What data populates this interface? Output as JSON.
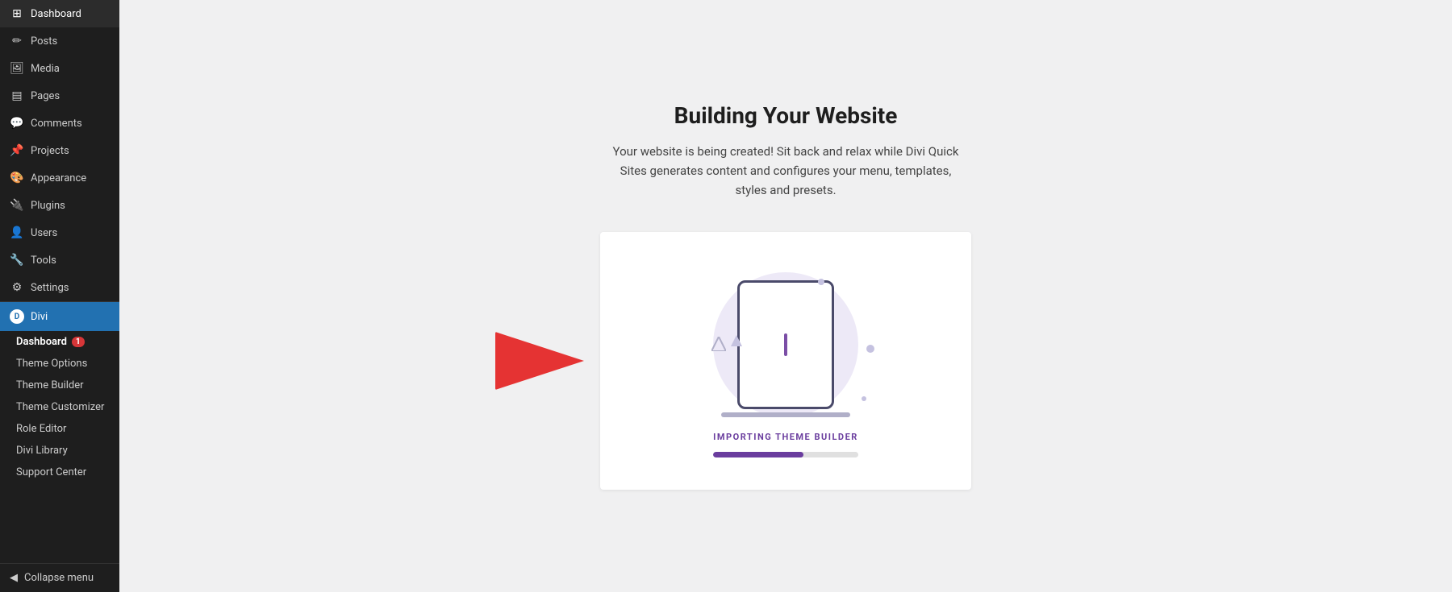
{
  "sidebar": {
    "items": [
      {
        "id": "dashboard",
        "label": "Dashboard",
        "icon": "⊞"
      },
      {
        "id": "posts",
        "label": "Posts",
        "icon": "✎"
      },
      {
        "id": "media",
        "label": "Media",
        "icon": "⊡"
      },
      {
        "id": "pages",
        "label": "Pages",
        "icon": "▤"
      },
      {
        "id": "comments",
        "label": "Comments",
        "icon": "💬"
      },
      {
        "id": "projects",
        "label": "Projects",
        "icon": "📌"
      },
      {
        "id": "appearance",
        "label": "Appearance",
        "icon": "🎨"
      },
      {
        "id": "plugins",
        "label": "Plugins",
        "icon": "🔌"
      },
      {
        "id": "users",
        "label": "Users",
        "icon": "👤"
      },
      {
        "id": "tools",
        "label": "Tools",
        "icon": "🔧"
      },
      {
        "id": "settings",
        "label": "Settings",
        "icon": "⚙"
      }
    ],
    "divi": {
      "header_label": "Divi",
      "icon": "D",
      "sub_items": [
        {
          "id": "divi-dashboard",
          "label": "Dashboard",
          "badge": "1",
          "active": true
        },
        {
          "id": "theme-options",
          "label": "Theme Options"
        },
        {
          "id": "theme-builder",
          "label": "Theme Builder"
        },
        {
          "id": "theme-customizer",
          "label": "Theme Customizer"
        },
        {
          "id": "role-editor",
          "label": "Role Editor"
        },
        {
          "id": "divi-library",
          "label": "Divi Library"
        },
        {
          "id": "support-center",
          "label": "Support Center"
        }
      ]
    },
    "collapse_label": "Collapse menu"
  },
  "main": {
    "title": "Building Your Website",
    "subtitle": "Your website is being created! Sit back and relax while Divi Quick Sites generates content and configures your menu, templates, styles and presets.",
    "card": {
      "status_label": "IMPORTING THEME BUILDER",
      "progress_percent": 62
    }
  },
  "colors": {
    "accent_purple": "#6a3d9e",
    "progress_track": "#e0e0e0",
    "progress_fill": "#6a3d9e",
    "circle_bg": "#ede9f7",
    "arrow_red": "#e53333",
    "sidebar_active": "#2271b1",
    "device_border": "#4a4a6a"
  }
}
